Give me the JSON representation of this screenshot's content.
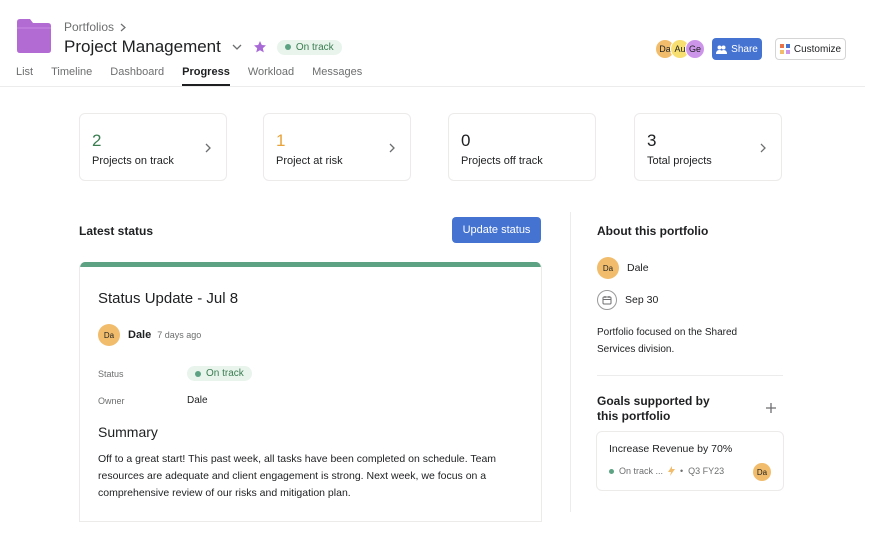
{
  "header": {
    "breadcrumb": "Portfolios",
    "title": "Project Management",
    "status": "On track",
    "members": [
      {
        "initials": "Da",
        "color": "#f1bd6c"
      },
      {
        "initials": "Au",
        "color": "#f8df72"
      },
      {
        "initials": "Ge",
        "color": "#cd95ea"
      }
    ],
    "share_label": "Share",
    "customize_label": "Customize",
    "folder_color": "#b36bd4",
    "accent_color": "#4573d2"
  },
  "tabs": [
    {
      "label": "List"
    },
    {
      "label": "Timeline"
    },
    {
      "label": "Dashboard"
    },
    {
      "label": "Progress",
      "active": true
    },
    {
      "label": "Workload"
    },
    {
      "label": "Messages"
    }
  ],
  "stats": [
    {
      "value": "2",
      "label": "Projects on track",
      "color": "#3a7d51"
    },
    {
      "value": "1",
      "label": "Project at risk",
      "color": "#e8a33b"
    },
    {
      "value": "0",
      "label": "Projects off track",
      "color": "#1e1f21"
    },
    {
      "value": "3",
      "label": "Total projects",
      "color": "#1e1f21"
    }
  ],
  "latest_status": {
    "heading": "Latest status",
    "update_button": "Update status",
    "card": {
      "title": "Status Update - Jul 8",
      "author_initials": "Da",
      "author": "Dale",
      "time": "7 days ago",
      "status_label": "Status",
      "status_value": "On track",
      "owner_label": "Owner",
      "owner_value": "Dale",
      "summary_title": "Summary",
      "summary_text": "Off to a great start! This past week, all tasks have been completed on schedule. Team resources are adequate and client engagement is strong. Next week, we focus on a comprehensive review of our risks and mitigation plan."
    }
  },
  "about": {
    "heading": "About this portfolio",
    "owner_initials": "Da",
    "owner": "Dale",
    "date": "Sep 30",
    "description": "Portfolio focused on the Shared Services division.",
    "goals_heading": "Goals supported by this portfolio",
    "goal": {
      "name": "Increase Revenue by 70%",
      "status": "On track ...",
      "period": "Q3 FY23",
      "owner_initials": "Da"
    }
  }
}
